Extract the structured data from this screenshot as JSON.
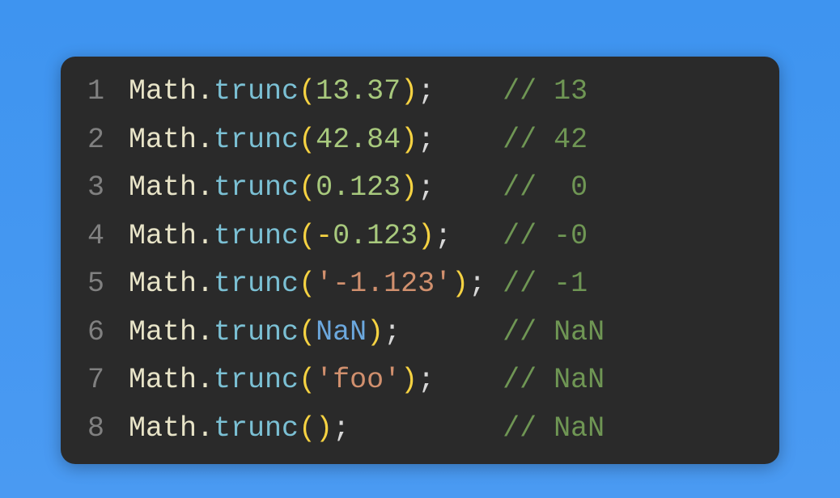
{
  "code": {
    "lines": [
      {
        "num": "1",
        "tokens": [
          {
            "t": "Math",
            "c": "obj"
          },
          {
            "t": ".",
            "c": "dot"
          },
          {
            "t": "trunc",
            "c": "fn"
          },
          {
            "t": "(",
            "c": "paren"
          },
          {
            "t": "13.37",
            "c": "num"
          },
          {
            "t": ")",
            "c": "paren"
          },
          {
            "t": ";",
            "c": "semi"
          },
          {
            "t": "    ",
            "c": "semi"
          },
          {
            "t": "// 13",
            "c": "comment"
          }
        ]
      },
      {
        "num": "2",
        "tokens": [
          {
            "t": "Math",
            "c": "obj"
          },
          {
            "t": ".",
            "c": "dot"
          },
          {
            "t": "trunc",
            "c": "fn"
          },
          {
            "t": "(",
            "c": "paren"
          },
          {
            "t": "42.84",
            "c": "num"
          },
          {
            "t": ")",
            "c": "paren"
          },
          {
            "t": ";",
            "c": "semi"
          },
          {
            "t": "    ",
            "c": "semi"
          },
          {
            "t": "// 42",
            "c": "comment"
          }
        ]
      },
      {
        "num": "3",
        "tokens": [
          {
            "t": "Math",
            "c": "obj"
          },
          {
            "t": ".",
            "c": "dot"
          },
          {
            "t": "trunc",
            "c": "fn"
          },
          {
            "t": "(",
            "c": "paren"
          },
          {
            "t": "0.123",
            "c": "num"
          },
          {
            "t": ")",
            "c": "paren"
          },
          {
            "t": ";",
            "c": "semi"
          },
          {
            "t": "    ",
            "c": "semi"
          },
          {
            "t": "//  0",
            "c": "comment"
          }
        ]
      },
      {
        "num": "4",
        "tokens": [
          {
            "t": "Math",
            "c": "obj"
          },
          {
            "t": ".",
            "c": "dot"
          },
          {
            "t": "trunc",
            "c": "fn"
          },
          {
            "t": "(",
            "c": "paren"
          },
          {
            "t": "-",
            "c": "op"
          },
          {
            "t": "0.123",
            "c": "num"
          },
          {
            "t": ")",
            "c": "paren"
          },
          {
            "t": ";",
            "c": "semi"
          },
          {
            "t": "   ",
            "c": "semi"
          },
          {
            "t": "// -0",
            "c": "comment"
          }
        ]
      },
      {
        "num": "5",
        "tokens": [
          {
            "t": "Math",
            "c": "obj"
          },
          {
            "t": ".",
            "c": "dot"
          },
          {
            "t": "trunc",
            "c": "fn"
          },
          {
            "t": "(",
            "c": "paren"
          },
          {
            "t": "'-1.123'",
            "c": "str"
          },
          {
            "t": ")",
            "c": "paren"
          },
          {
            "t": ";",
            "c": "semi"
          },
          {
            "t": " ",
            "c": "semi"
          },
          {
            "t": "// -1",
            "c": "comment"
          }
        ]
      },
      {
        "num": "6",
        "tokens": [
          {
            "t": "Math",
            "c": "obj"
          },
          {
            "t": ".",
            "c": "dot"
          },
          {
            "t": "trunc",
            "c": "fn"
          },
          {
            "t": "(",
            "c": "paren"
          },
          {
            "t": "NaN",
            "c": "const"
          },
          {
            "t": ")",
            "c": "paren"
          },
          {
            "t": ";",
            "c": "semi"
          },
          {
            "t": "      ",
            "c": "semi"
          },
          {
            "t": "// NaN",
            "c": "comment"
          }
        ]
      },
      {
        "num": "7",
        "tokens": [
          {
            "t": "Math",
            "c": "obj"
          },
          {
            "t": ".",
            "c": "dot"
          },
          {
            "t": "trunc",
            "c": "fn"
          },
          {
            "t": "(",
            "c": "paren"
          },
          {
            "t": "'foo'",
            "c": "str"
          },
          {
            "t": ")",
            "c": "paren"
          },
          {
            "t": ";",
            "c": "semi"
          },
          {
            "t": "    ",
            "c": "semi"
          },
          {
            "t": "// NaN",
            "c": "comment"
          }
        ]
      },
      {
        "num": "8",
        "tokens": [
          {
            "t": "Math",
            "c": "obj"
          },
          {
            "t": ".",
            "c": "dot"
          },
          {
            "t": "trunc",
            "c": "fn"
          },
          {
            "t": "(",
            "c": "paren"
          },
          {
            "t": ")",
            "c": "paren"
          },
          {
            "t": ";",
            "c": "semi"
          },
          {
            "t": "         ",
            "c": "semi"
          },
          {
            "t": "// NaN",
            "c": "comment"
          }
        ]
      }
    ]
  }
}
